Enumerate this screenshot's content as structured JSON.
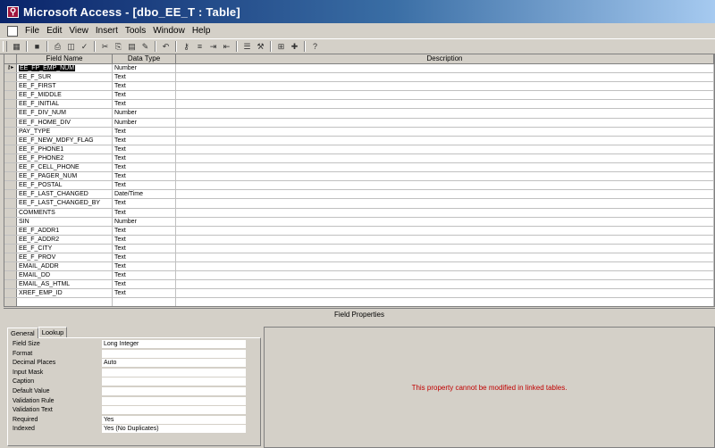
{
  "window": {
    "title": "Microsoft Access - [dbo_EE_T : Table]"
  },
  "menu": [
    "File",
    "Edit",
    "View",
    "Insert",
    "Tools",
    "Window",
    "Help"
  ],
  "toolbar": {
    "buttons": [
      "view-icon",
      "save-icon",
      "print-icon",
      "print-preview-icon",
      "spelling-icon",
      "cut-icon",
      "copy-icon",
      "paste-icon",
      "format-painter-icon",
      "undo-icon",
      "primary-key-icon",
      "indexes-icon",
      "insert-rows-icon",
      "delete-rows-icon",
      "properties-icon",
      "build-icon",
      "database-window-icon",
      "new-object-icon",
      "help-icon"
    ]
  },
  "grid": {
    "headers": {
      "field_name": "Field Name",
      "data_type": "Data Type",
      "description": "Description"
    },
    "rows": [
      {
        "name": "EE_FP_EMP_NUM",
        "type": "Number"
      },
      {
        "name": "EE_F_SUR",
        "type": "Text"
      },
      {
        "name": "EE_F_FIRST",
        "type": "Text"
      },
      {
        "name": "EE_F_MIDDLE",
        "type": "Text"
      },
      {
        "name": "EE_F_INITIAL",
        "type": "Text"
      },
      {
        "name": "EE_F_DIV_NUM",
        "type": "Number"
      },
      {
        "name": "EE_F_HOME_DIV",
        "type": "Number"
      },
      {
        "name": "PAY_TYPE",
        "type": "Text"
      },
      {
        "name": "EE_F_NEW_MDFY_FLAG",
        "type": "Text"
      },
      {
        "name": "EE_F_PHONE1",
        "type": "Text"
      },
      {
        "name": "EE_F_PHONE2",
        "type": "Text"
      },
      {
        "name": "EE_F_CELL_PHONE",
        "type": "Text"
      },
      {
        "name": "EE_F_PAGER_NUM",
        "type": "Text"
      },
      {
        "name": "EE_F_POSTAL",
        "type": "Text"
      },
      {
        "name": "EE_F_LAST_CHANGED",
        "type": "Date/Time"
      },
      {
        "name": "EE_F_LAST_CHANGED_BY",
        "type": "Text"
      },
      {
        "name": "COMMENTS",
        "type": "Text"
      },
      {
        "name": "SIN",
        "type": "Number"
      },
      {
        "name": "EE_F_ADDR1",
        "type": "Text"
      },
      {
        "name": "EE_F_ADDR2",
        "type": "Text"
      },
      {
        "name": "EE_F_CITY",
        "type": "Text"
      },
      {
        "name": "EE_F_PROV",
        "type": "Text"
      },
      {
        "name": "EMAIL_ADDR",
        "type": "Text"
      },
      {
        "name": "EMAIL_DD",
        "type": "Text"
      },
      {
        "name": "EMAIL_AS_HTML",
        "type": "Text"
      },
      {
        "name": "XREF_EMP_ID",
        "type": "Text"
      }
    ],
    "empty_rows": 1
  },
  "field_properties": {
    "title": "Field Properties",
    "tabs": [
      "General",
      "Lookup"
    ],
    "properties": [
      {
        "label": "Field Size",
        "value": "Long Integer"
      },
      {
        "label": "Format",
        "value": ""
      },
      {
        "label": "Decimal Places",
        "value": "Auto"
      },
      {
        "label": "Input Mask",
        "value": ""
      },
      {
        "label": "Caption",
        "value": ""
      },
      {
        "label": "Default Value",
        "value": ""
      },
      {
        "label": "Validation Rule",
        "value": ""
      },
      {
        "label": "Validation Text",
        "value": ""
      },
      {
        "label": "Required",
        "value": "Yes"
      },
      {
        "label": "Indexed",
        "value": "Yes (No Duplicates)"
      }
    ],
    "message": "This property cannot be modified in linked tables."
  }
}
